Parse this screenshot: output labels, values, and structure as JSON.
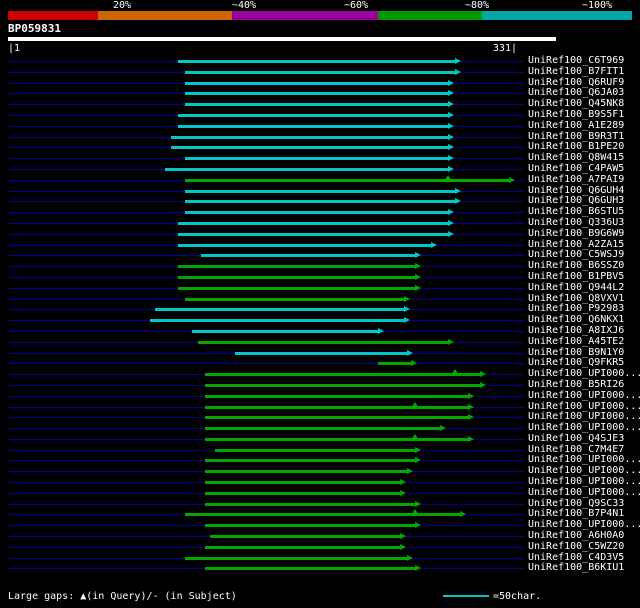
{
  "color_key": {
    "segments": [
      {
        "label": "20%",
        "color": "#cc0000"
      },
      {
        "label": "~40%",
        "color": "#cc6600"
      },
      {
        "label": "~60%",
        "color": "#990099"
      },
      {
        "label": "~80%",
        "color": "#009900"
      },
      {
        "label": "~100%",
        "color": "#00a8a8"
      }
    ]
  },
  "query": {
    "name": "BP059831",
    "start_label": "|1",
    "end_label": "331|",
    "length": 331
  },
  "colors": {
    "cyan": "#00c8c8",
    "green": "#00a800"
  },
  "footer": {
    "legend": "Large gaps: ▲(in Query)/- (in Subject)",
    "scale_note": "=50char."
  },
  "chart_data": {
    "type": "bar",
    "subtype": "blast-hit-overview-span-chart",
    "title": "BP059831",
    "x_axis": {
      "label": "query position",
      "min": 1,
      "max": 331
    },
    "legend_position": "top",
    "grid": false,
    "identity_key": [
      "20%",
      "~40%",
      "~60%",
      "~80%",
      "~100%"
    ],
    "hits": [
      {
        "label": "UniRef100_C6T969",
        "color": "cyan",
        "start": 111,
        "end": 291
      },
      {
        "label": "UniRef100_B7FIT1",
        "color": "cyan",
        "start": 116,
        "end": 291
      },
      {
        "label": "UniRef100_Q6RUF9",
        "color": "cyan",
        "start": 116,
        "end": 286
      },
      {
        "label": "UniRef100_Q6JA03",
        "color": "cyan",
        "start": 116,
        "end": 286
      },
      {
        "label": "UniRef100_Q45NK8",
        "color": "cyan",
        "start": 116,
        "end": 286
      },
      {
        "label": "UniRef100_B9S5F1",
        "color": "cyan",
        "start": 111,
        "end": 286
      },
      {
        "label": "UniRef100_A1E289",
        "color": "cyan",
        "start": 111,
        "end": 286
      },
      {
        "label": "UniRef100_B9R3T1",
        "color": "cyan",
        "start": 107,
        "end": 286
      },
      {
        "label": "UniRef100_B1PE20",
        "color": "cyan",
        "start": 107,
        "end": 286
      },
      {
        "label": "UniRef100_Q8W415",
        "color": "cyan",
        "start": 116,
        "end": 286
      },
      {
        "label": "UniRef100_C4PAW5",
        "color": "cyan",
        "start": 103,
        "end": 286
      },
      {
        "label": "UniRef100_A7PAI9",
        "color": "green",
        "start": 116,
        "end": 326,
        "gaps": [
          286
        ]
      },
      {
        "label": "UniRef100_Q6GUH4",
        "color": "cyan",
        "start": 116,
        "end": 291
      },
      {
        "label": "UniRef100_Q6GUH3",
        "color": "cyan",
        "start": 116,
        "end": 291
      },
      {
        "label": "UniRef100_B6STU5",
        "color": "cyan",
        "start": 116,
        "end": 286
      },
      {
        "label": "UniRef100_Q336U3",
        "color": "cyan",
        "start": 111,
        "end": 286
      },
      {
        "label": "UniRef100_B9G6W9",
        "color": "cyan",
        "start": 111,
        "end": 286
      },
      {
        "label": "UniRef100_A2ZA15",
        "color": "cyan",
        "start": 111,
        "end": 275
      },
      {
        "label": "UniRef100_C5WSJ9",
        "color": "cyan",
        "start": 126,
        "end": 265
      },
      {
        "label": "UniRef100_B6SSZ0",
        "color": "green",
        "start": 111,
        "end": 265
      },
      {
        "label": "UniRef100_B1PBV5",
        "color": "green",
        "start": 111,
        "end": 265
      },
      {
        "label": "UniRef100_Q944L2",
        "color": "green",
        "start": 111,
        "end": 265
      },
      {
        "label": "UniRef100_Q8VXV1",
        "color": "green",
        "start": 116,
        "end": 258
      },
      {
        "label": "UniRef100_P92983",
        "color": "cyan",
        "start": 96,
        "end": 258
      },
      {
        "label": "UniRef100_Q6NKX1",
        "color": "cyan",
        "start": 93,
        "end": 258
      },
      {
        "label": "UniRef100_A8IXJ6",
        "color": "cyan",
        "start": 120,
        "end": 241
      },
      {
        "label": "UniRef100_A45TE2",
        "color": "green",
        "start": 124,
        "end": 286
      },
      {
        "label": "UniRef100_B9N1Y0",
        "color": "cyan",
        "start": 148,
        "end": 260
      },
      {
        "label": "UniRef100_Q9FKR5",
        "color": "green",
        "start": 241,
        "end": 262
      },
      {
        "label": "UniRef100_UPI000...",
        "color": "green",
        "start": 129,
        "end": 307,
        "gaps": [
          291
        ]
      },
      {
        "label": "UniRef100_B5RI26",
        "color": "green",
        "start": 129,
        "end": 307
      },
      {
        "label": "UniRef100_UPI000...",
        "color": "green",
        "start": 129,
        "end": 299
      },
      {
        "label": "UniRef100_UPI000...",
        "color": "green",
        "start": 129,
        "end": 299,
        "gaps": [
          265
        ]
      },
      {
        "label": "UniRef100_UPI000...",
        "color": "green",
        "start": 129,
        "end": 299
      },
      {
        "label": "UniRef100_UPI000...",
        "color": "green",
        "start": 129,
        "end": 281
      },
      {
        "label": "UniRef100_Q4SJE3",
        "color": "green",
        "start": 129,
        "end": 299,
        "gaps": [
          265
        ]
      },
      {
        "label": "UniRef100_C7M4E7",
        "color": "green",
        "start": 135,
        "end": 265
      },
      {
        "label": "UniRef100_UPI000...",
        "color": "green",
        "start": 129,
        "end": 265
      },
      {
        "label": "UniRef100_UPI000...",
        "color": "green",
        "start": 129,
        "end": 260
      },
      {
        "label": "UniRef100_UPI000...",
        "color": "green",
        "start": 129,
        "end": 255
      },
      {
        "label": "UniRef100_UPI000...",
        "color": "green",
        "start": 129,
        "end": 255
      },
      {
        "label": "UniRef100_Q9SC33",
        "color": "green",
        "start": 129,
        "end": 265
      },
      {
        "label": "UniRef100_B7P4N1",
        "color": "green",
        "start": 116,
        "end": 294,
        "gaps": [
          265
        ]
      },
      {
        "label": "UniRef100_UPI000...",
        "color": "green",
        "start": 129,
        "end": 265
      },
      {
        "label": "UniRef100_A6H0A0",
        "color": "green",
        "start": 132,
        "end": 255
      },
      {
        "label": "UniRef100_C5WZ20",
        "color": "green",
        "start": 129,
        "end": 255
      },
      {
        "label": "UniRef100_C4D3V5",
        "color": "green",
        "start": 116,
        "end": 260
      },
      {
        "label": "UniRef100_B6KIU1",
        "color": "green",
        "start": 129,
        "end": 265
      }
    ]
  }
}
